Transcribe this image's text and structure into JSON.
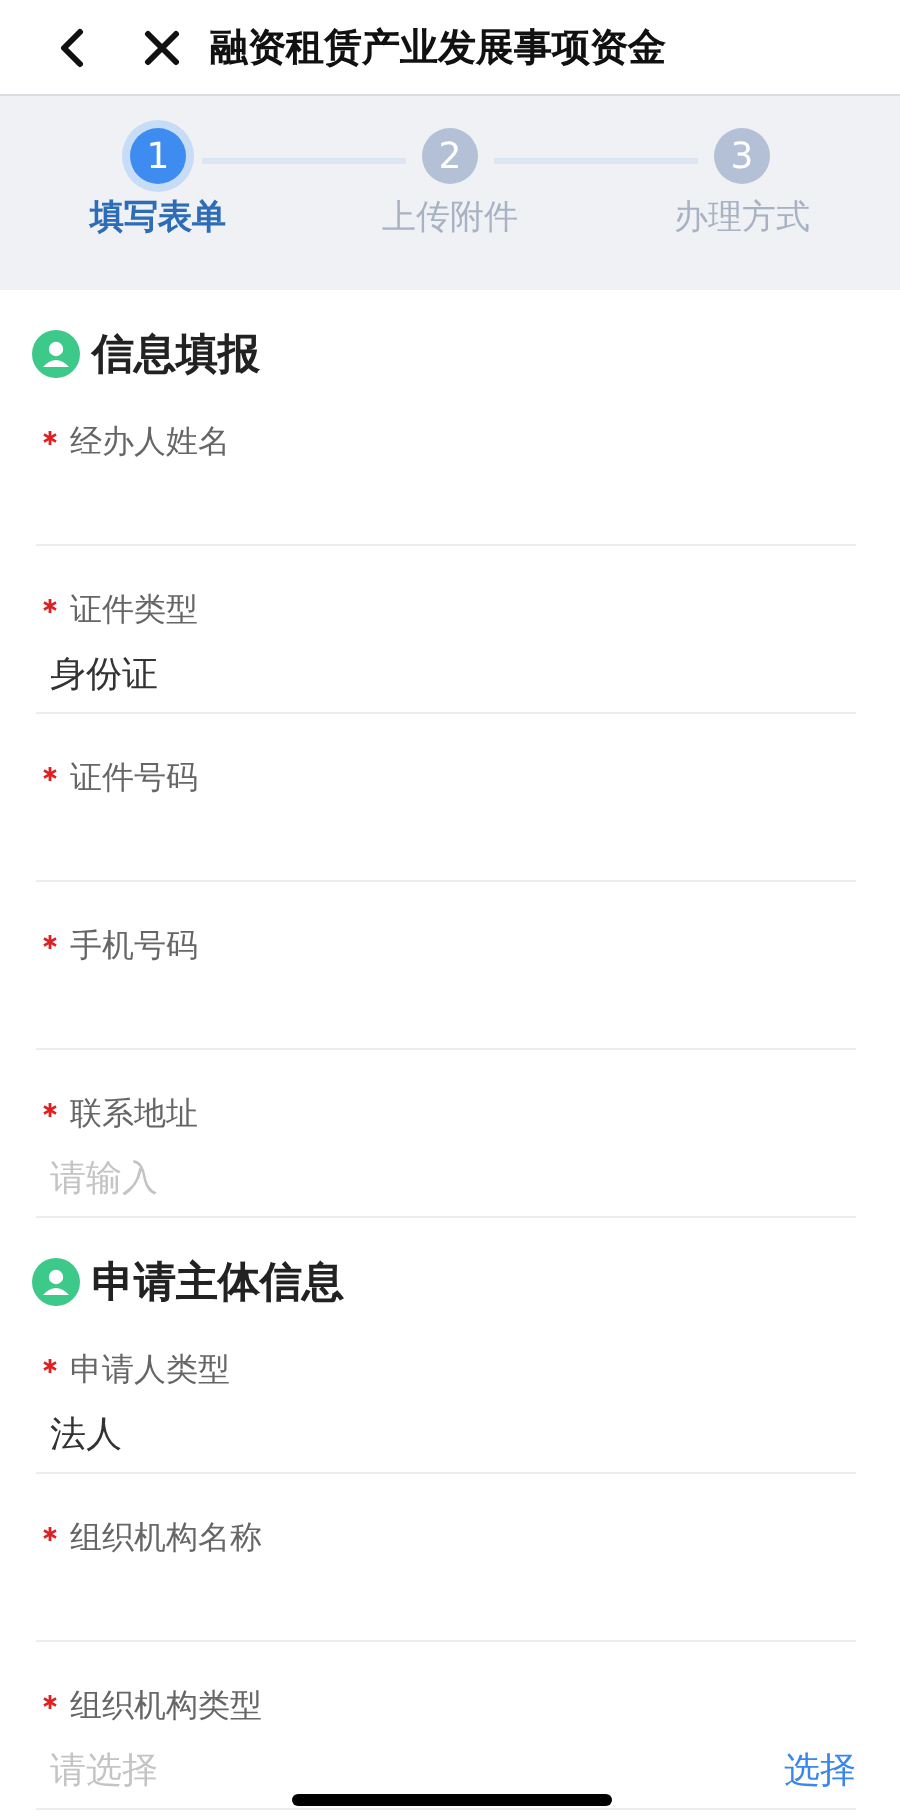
{
  "header": {
    "title": "融资租赁产业发展事项资金"
  },
  "steps": [
    {
      "number": "1",
      "label": "填写表单",
      "selected": true
    },
    {
      "number": "2",
      "label": "上传附件",
      "selected": false
    },
    {
      "number": "3",
      "label": "办理方式",
      "selected": false
    }
  ],
  "sections": [
    {
      "title": "信息填报",
      "fields": [
        {
          "label": "经办人姓名",
          "required": true
        },
        {
          "label": "证件类型",
          "required": true,
          "value": "身份证"
        },
        {
          "label": "证件号码",
          "required": true
        },
        {
          "label": "手机号码",
          "required": true
        },
        {
          "label": "联系地址",
          "required": true,
          "placeholder": "请输入"
        }
      ]
    },
    {
      "title": "申请主体信息",
      "fields": [
        {
          "label": "申请人类型",
          "required": true,
          "value": "法人"
        },
        {
          "label": "组织机构名称",
          "required": true
        },
        {
          "label": "组织机构类型",
          "required": true,
          "placeholder": "请选择",
          "action": "选择"
        }
      ]
    }
  ]
}
